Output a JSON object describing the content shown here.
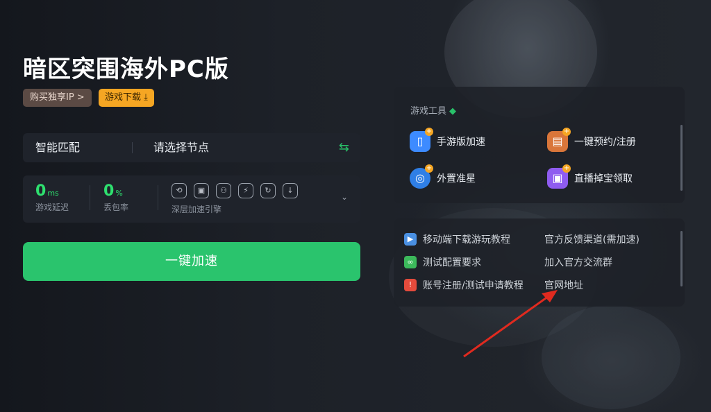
{
  "game": {
    "title": "暗区突围海外PC版",
    "buy_ip_label": "购买独享IP >",
    "download_label": "游戏下载 ⤓"
  },
  "node": {
    "mode": "智能匹配",
    "select_placeholder": "请选择节点",
    "swap_icon": "⇆"
  },
  "stats": {
    "latency_value": "0",
    "latency_unit": "ms",
    "latency_label": "游戏延迟",
    "loss_value": "0",
    "loss_unit": "%",
    "loss_label": "丢包率",
    "engine_label": "深层加速引擎",
    "engine_icons": [
      "⟲",
      "▣",
      "⚇",
      "⚡",
      "↻",
      "↓"
    ],
    "expand_icon": "⌄"
  },
  "accelerate_button": "一键加速",
  "tools": {
    "header": "游戏工具",
    "header_icon": "◆",
    "items": [
      {
        "label": "手游版加速",
        "icon": "mobile-icon",
        "color": "#3d8bff",
        "glyph": "▯"
      },
      {
        "label": "一键预约/注册",
        "icon": "calendar-icon",
        "color": "#d9763a",
        "glyph": "▤"
      },
      {
        "label": "外置准星",
        "icon": "crosshair-icon",
        "color": "#2f7fe6",
        "glyph": "◎"
      },
      {
        "label": "直播掉宝领取",
        "icon": "live-gift-icon",
        "color": "#8f5cf0",
        "glyph": "▣"
      }
    ],
    "plus_glyph": "+"
  },
  "links": {
    "left": [
      {
        "label": "移动端下载游玩教程",
        "icon": "video-icon",
        "color": "#4a90e2",
        "glyph": "▶"
      },
      {
        "label": "测试配置要求",
        "icon": "link-icon",
        "color": "#3cb95b",
        "glyph": "∞"
      },
      {
        "label": "账号注册/测试申请教程",
        "icon": "warning-icon",
        "color": "#e54b3c",
        "glyph": "!"
      }
    ],
    "right": [
      {
        "label": "官方反馈渠道(需加速)"
      },
      {
        "label": "加入官方交流群"
      },
      {
        "label": "官网地址"
      }
    ]
  },
  "colors": {
    "accent_green": "#2ac46d",
    "download_orange": "#f5a623",
    "annotation_red": "#e02a1f"
  }
}
